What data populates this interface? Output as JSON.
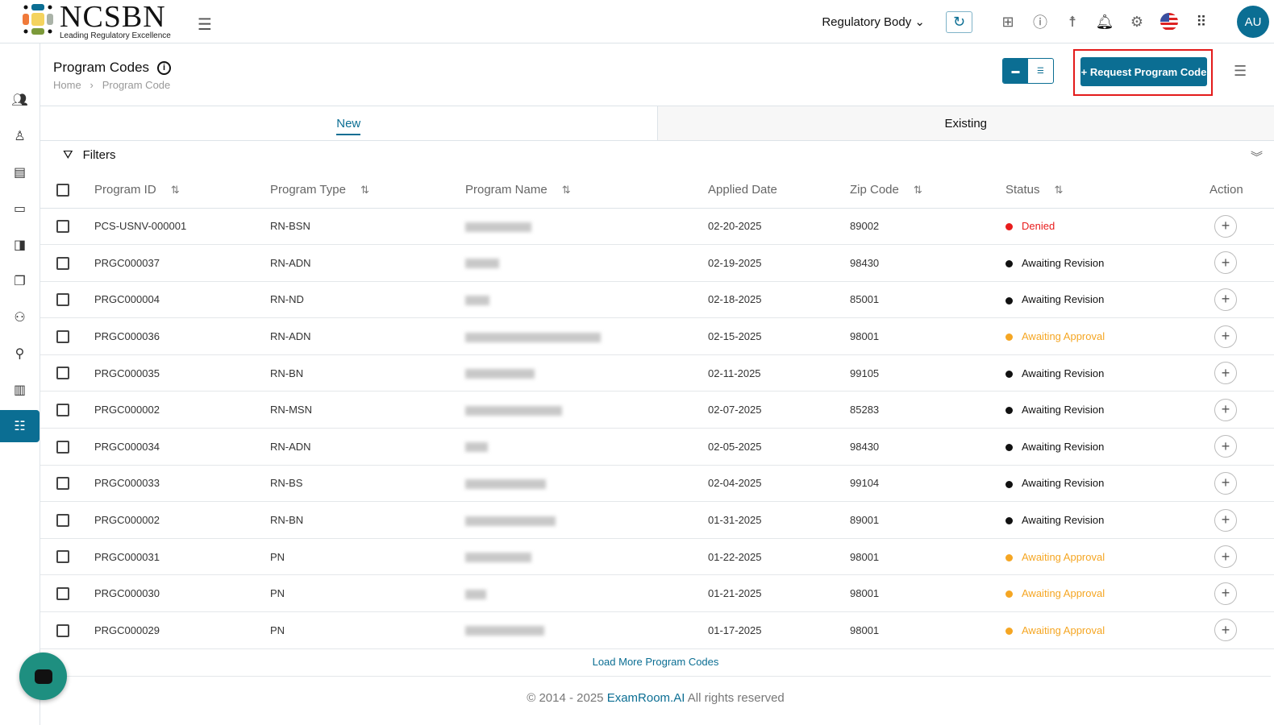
{
  "brand": {
    "name": "NCSBN",
    "tagline": "Leading Regulatory Excellence"
  },
  "header": {
    "regulatory_body": "Regulatory Body",
    "avatar": "AU",
    "icons": [
      "refresh-icon",
      "apps-add-icon",
      "help-icon",
      "accessibility-icon",
      "bell-icon",
      "gear-icon",
      "us-flag-icon",
      "grid-icon"
    ]
  },
  "page": {
    "title": "Program Codes",
    "breadcrumb": [
      "Home",
      "Program Code"
    ],
    "request_button": "+ Request Program Code"
  },
  "tabs": [
    "New",
    "Existing"
  ],
  "filters_label": "Filters",
  "columns": [
    "Program ID",
    "Program Type",
    "Program Name",
    "Applied Date",
    "Zip Code",
    "Status",
    "Action"
  ],
  "rows": [
    {
      "id": "PCS-USNV-000001",
      "type": "RN-BSN",
      "date": "02-20-2025",
      "zip": "89002",
      "status": "Denied"
    },
    {
      "id": "PRGC000037",
      "type": "RN-ADN",
      "date": "02-19-2025",
      "zip": "98430",
      "status": "Awaiting Revision"
    },
    {
      "id": "PRGC000004",
      "type": "RN-ND",
      "date": "02-18-2025",
      "zip": "85001",
      "status": "Awaiting Revision"
    },
    {
      "id": "PRGC000036",
      "type": "RN-ADN",
      "date": "02-15-2025",
      "zip": "98001",
      "status": "Awaiting Approval"
    },
    {
      "id": "PRGC000035",
      "type": "RN-BN",
      "date": "02-11-2025",
      "zip": "99105",
      "status": "Awaiting Revision"
    },
    {
      "id": "PRGC000002",
      "type": "RN-MSN",
      "date": "02-07-2025",
      "zip": "85283",
      "status": "Awaiting Revision"
    },
    {
      "id": "PRGC000034",
      "type": "RN-ADN",
      "date": "02-05-2025",
      "zip": "98430",
      "status": "Awaiting Revision"
    },
    {
      "id": "PRGC000033",
      "type": "RN-BS",
      "date": "02-04-2025",
      "zip": "99104",
      "status": "Awaiting Revision"
    },
    {
      "id": "PRGC000002",
      "type": "RN-BN",
      "date": "01-31-2025",
      "zip": "89001",
      "status": "Awaiting Revision"
    },
    {
      "id": "PRGC000031",
      "type": "PN",
      "date": "01-22-2025",
      "zip": "98001",
      "status": "Awaiting Approval"
    },
    {
      "id": "PRGC000030",
      "type": "PN",
      "date": "01-21-2025",
      "zip": "98001",
      "status": "Awaiting Approval"
    },
    {
      "id": "PRGC000029",
      "type": "PN",
      "date": "01-17-2025",
      "zip": "98001",
      "status": "Awaiting Approval"
    }
  ],
  "status_colors": {
    "Denied": "#e81c1c",
    "Awaiting Revision": "#111111",
    "Awaiting Approval": "#f5a623"
  },
  "load_more": "Load More Program Codes",
  "footer": {
    "prefix": "© 2014 - 2025 ",
    "link": "ExamRoom.AI",
    "suffix": " All rights reserved"
  }
}
